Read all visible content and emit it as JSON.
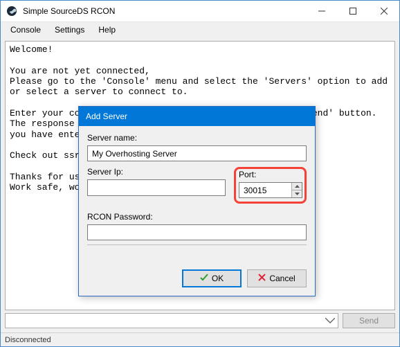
{
  "window": {
    "title": "Simple SourceDS RCON"
  },
  "menu": {
    "console": "Console",
    "settings": "Settings",
    "help": "Help"
  },
  "console_text": "Welcome!\n\nYou are not yet connected,\nPlease go to the 'Console' menu and select the 'Servers' option to add or select a server to connect to.\n\nEnter your command into the input field and press the 'Send' button.\nThe response from the server, as well as any commands\nyou have entered will be printed here.\n\nCheck out ssrcon online at\n\nThanks for using Simple Source RCON!\nWork safe, work smart.",
  "cmd": {
    "value": "",
    "send": "Send"
  },
  "status": "Disconnected",
  "dialog": {
    "title": "Add Server",
    "server_name_label": "Server name:",
    "server_name_value": "My Overhosting Server",
    "server_ip_label": "Server Ip:",
    "server_ip_value": "",
    "port_label": "Port:",
    "port_value": "30015",
    "rcon_label": "RCON Password:",
    "rcon_value": "",
    "ok": "OK",
    "cancel": "Cancel"
  }
}
